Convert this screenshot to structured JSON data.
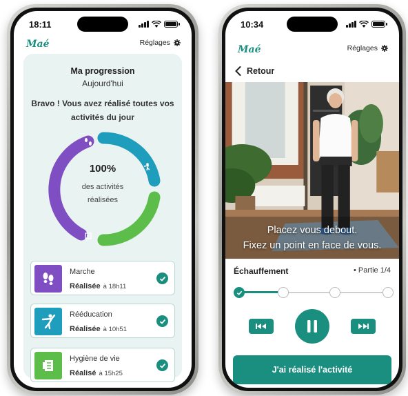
{
  "colors": {
    "accent": "#1a8f7f",
    "purple": "#7f4ec2",
    "teal": "#1f9dbd",
    "green": "#5cbd4a"
  },
  "left": {
    "status_time": "18:11",
    "logo": "Maé",
    "settings_label": "Réglages",
    "progress": {
      "title": "Ma progression",
      "subtitle": "Aujourd'hui",
      "message": "Bravo ! Vous avez réalisé toutes vos activités du jour",
      "percent_label": "100%",
      "percent_caption": "des activités réalisées",
      "percent_value": 100
    },
    "activities": [
      {
        "name": "Marche",
        "status": "Réalisée",
        "time": "à 18h11",
        "icon": "footprints-icon"
      },
      {
        "name": "Rééducation",
        "status": "Réalisée",
        "time": "à 10h51",
        "icon": "exercise-icon"
      },
      {
        "name": "Hygiène de vie",
        "status": "Réalisé",
        "time": "à 15h25",
        "icon": "notebook-icon"
      }
    ]
  },
  "right": {
    "status_time": "10:34",
    "logo": "Maé",
    "settings_label": "Réglages",
    "back_label": "Retour",
    "caption_line1": "Placez vous debout.",
    "caption_line2": "Fixez un point en face de vous.",
    "section_title": "Échauffement",
    "part_label": "Partie 1/4",
    "step_current": 1,
    "step_total": 4,
    "cta_label": "J'ai réalisé l'activité"
  }
}
